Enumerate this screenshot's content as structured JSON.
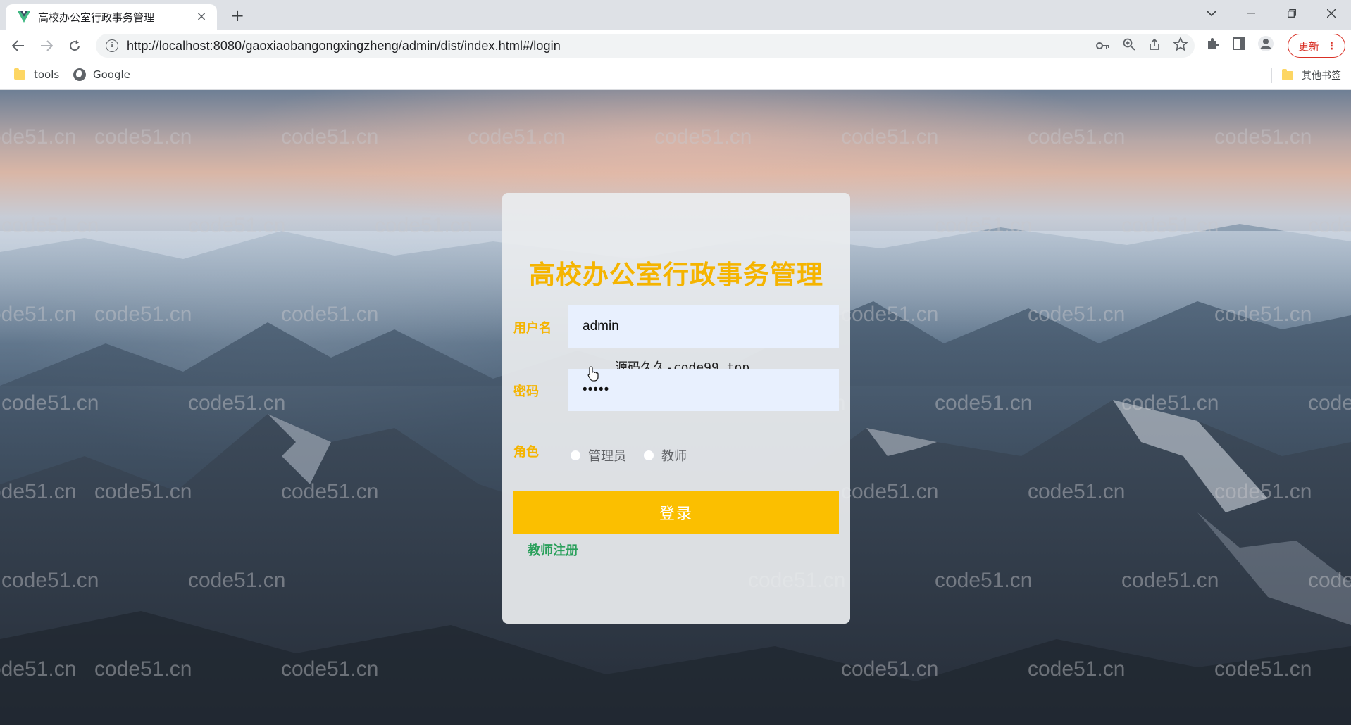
{
  "browser": {
    "tab_title": "高校办公室行政事务管理",
    "tab_close": "×",
    "new_tab": "+",
    "url": "http://localhost:8080/gaoxiaobangongxingzheng/admin/dist/index.html#/login",
    "update_label": "更新",
    "update_menu": "⋮",
    "icons": [
      "back-icon",
      "forward-icon",
      "reload-icon",
      "info-icon",
      "key-icon",
      "zoom-icon",
      "share-icon",
      "star-icon",
      "extensions-icon",
      "sidepanel-icon",
      "profile-icon"
    ]
  },
  "bookmarks": {
    "items": [
      {
        "label": "tools",
        "icon": "folder-icon"
      },
      {
        "label": "Google",
        "icon": "globe-icon"
      }
    ],
    "other": "其他书签"
  },
  "watermark": "code51.cn",
  "login": {
    "title": "高校办公室行政事务管理",
    "username_label": "用户名",
    "username_value": "admin",
    "password_label": "密码",
    "password_value": "•••••",
    "overlay_text": "源码久久-code99.top",
    "role_label": "角色",
    "roles": [
      "管理员",
      "教师"
    ],
    "login_button": "登录",
    "register_link": "教师注册"
  },
  "colors": {
    "accent": "#f5b400",
    "button": "#fbbf00",
    "link": "#2aa05b",
    "input_bg": "#e8f0fe"
  }
}
